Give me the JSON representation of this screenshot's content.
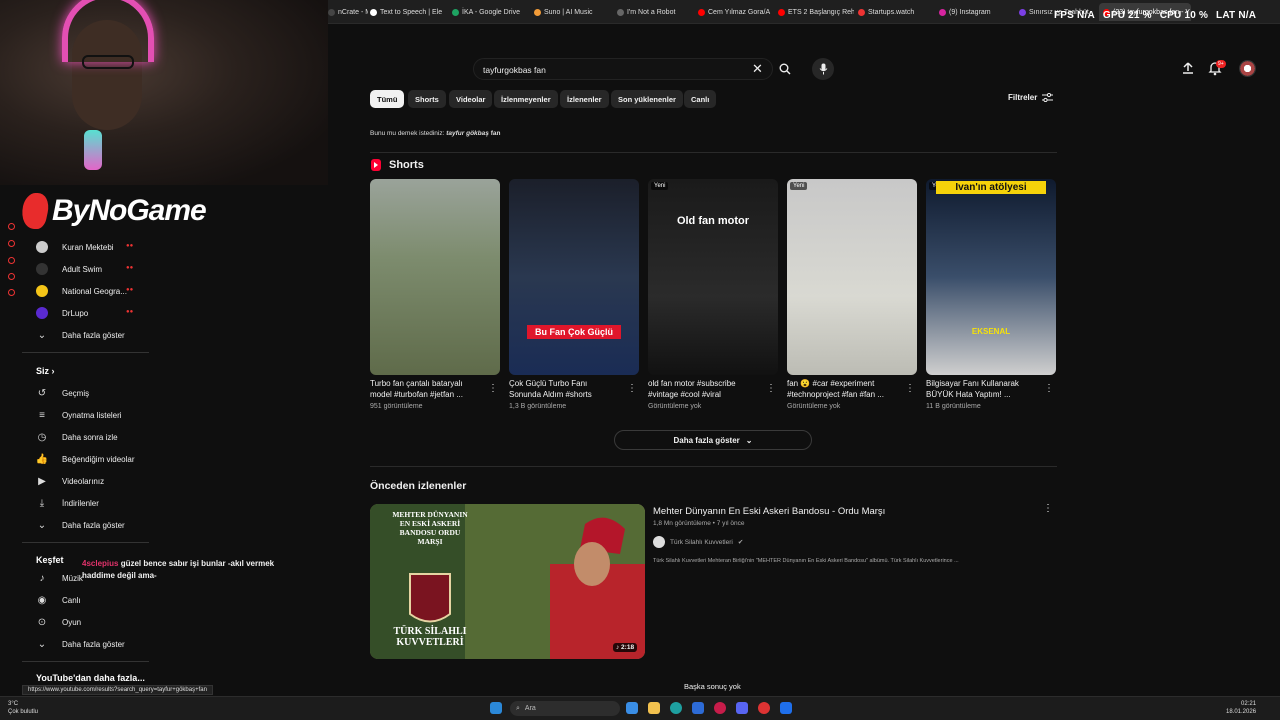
{
  "browser": {
    "tabs": [
      {
        "label": "nCrate - M",
        "color": "#444"
      },
      {
        "label": "Text to Speech | Ele",
        "color": "#fff"
      },
      {
        "label": "İKA - Google Drive",
        "color": "#1ea362"
      },
      {
        "label": "Suno | AI Music",
        "color": "#f29b38"
      },
      {
        "label": "I'm Not a Robot",
        "color": "#666"
      },
      {
        "label": "Cem Yılmaz Gora/A",
        "color": "#f00"
      },
      {
        "label": "ETS 2 Başlangıç Reh",
        "color": "#f00"
      },
      {
        "label": "Startups.watch",
        "color": "#e33"
      },
      {
        "label": "(9) Instagram",
        "color": "#d6249f"
      },
      {
        "label": "Sınırsız ve Taahhüt",
        "color": "#7b3fe4"
      },
      {
        "label": "(23) tayfurgokbas fan - Y",
        "color": "#f00"
      }
    ],
    "status_url": "https://www.youtube.com/results?search_query=tayfur+gökbaş+fan"
  },
  "perf": {
    "fps_label": "FPS",
    "fps": "N/A",
    "gpu_label": "GPU",
    "gpu": "21 %",
    "cpu_label": "CPU",
    "cpu": "10 %",
    "lat_label": "LAT",
    "lat": "N/A"
  },
  "overlay": {
    "logo": "ByNoGame"
  },
  "sidebar": {
    "subs": [
      {
        "label": "Kuran Mektebi",
        "color": "#ccc"
      },
      {
        "label": "Adult Swim",
        "color": "#333"
      },
      {
        "label": "National Geogra...",
        "color": "#f5c518"
      },
      {
        "label": "DrLupo",
        "color": "#5a2ad0"
      }
    ],
    "show_more": "Daha fazla göster",
    "you_heading": "Siz",
    "you_items": [
      "Geçmiş",
      "Oynatma listeleri",
      "Daha sonra izle",
      "Beğendiğim videolar",
      "Videolarınız",
      "İndirilenler"
    ],
    "you_more": "Daha fazla göster",
    "explore_heading": "Keşfet",
    "explore_items": [
      "Müzik",
      "Canlı",
      "Oyun"
    ],
    "explore_more": "Daha fazla göster",
    "footer_heading": "YouTube'dan daha fazla..."
  },
  "search": {
    "query": "tayfurgokbas fan"
  },
  "notifications_badge": "9+",
  "chips": [
    "Tümü",
    "Shorts",
    "Videolar",
    "İzlenmeyenler",
    "İzlenenler",
    "Son yüklenenler",
    "Canlı"
  ],
  "filters_label": "Filtreler",
  "did_you_mean": {
    "prefix": "Bunu mu demek istediniz:",
    "bold_italic": "tayfur gökbaş",
    "suffix": "fan"
  },
  "shorts": {
    "heading": "Shorts",
    "items": [
      {
        "title": "Turbo fan çantalı bataryalı model #turbofan #jetfan ...",
        "views": "951 görüntüleme",
        "badge": "",
        "overlay": ""
      },
      {
        "title": "Çok Güçlü Turbo Fanı Sonunda Aldım #shorts",
        "views": "1,3 B görüntüleme",
        "badge": "",
        "overlay": "Bu Fan Çok Güçlü"
      },
      {
        "title": "old fan motor #subscribe #vintage #cool #viral",
        "views": "Görüntüleme yok",
        "badge": "Yeni",
        "overlay": "Old fan motor"
      },
      {
        "title": "fan 😮 #car #experiment #technoproject #fan #fan ...",
        "views": "Görüntüleme yok",
        "badge": "Yeni",
        "overlay": ""
      },
      {
        "title": "Bilgisayar Fanı Kullanarak BÜYÜK Hata Yaptım! ...",
        "views": "11 B görüntüleme",
        "badge": "Yeni",
        "overlay": "Ivan'ın atölyesi",
        "overlay2": "EKSENAL"
      }
    ],
    "more_button": "Daha fazla göster"
  },
  "previously_watched": {
    "heading": "Önceden izlenenler",
    "video": {
      "title": "Mehter Dünyanın En Eski Askeri Bandosu - Ordu Marşı",
      "meta": "1,8 Mn görüntüleme • 7 yıl önce",
      "channel": "Türk Silahlı Kuvvetleri",
      "description": "Türk Silahlı Kuvvetleri Mehteran Birliği'nin \"MEHTER Dünyanın En Eski Askeri Bandosu\" albümü. Türk Silahlı Kuvvetlerince ...",
      "duration": "♪ 2:18",
      "thumb_text_top": "MEHTER DÜNYANIN EN ESKİ ASKERİ BANDOSU ORDU MARŞI",
      "thumb_text_bottom": "TÜRK SİLAHLI KUVVETLERİ"
    }
  },
  "no_more_results": "Başka sonuç yok",
  "chat": {
    "user": "4sclepius",
    "message": "güzel bence sabır işi bunlar -akıl vermek haddime değil ama-"
  },
  "taskbar": {
    "weather_temp": "3°C",
    "weather_desc": "Çok bulutlu",
    "search_placeholder": "Ara",
    "time": "02:21",
    "date": "18.01.2026"
  }
}
